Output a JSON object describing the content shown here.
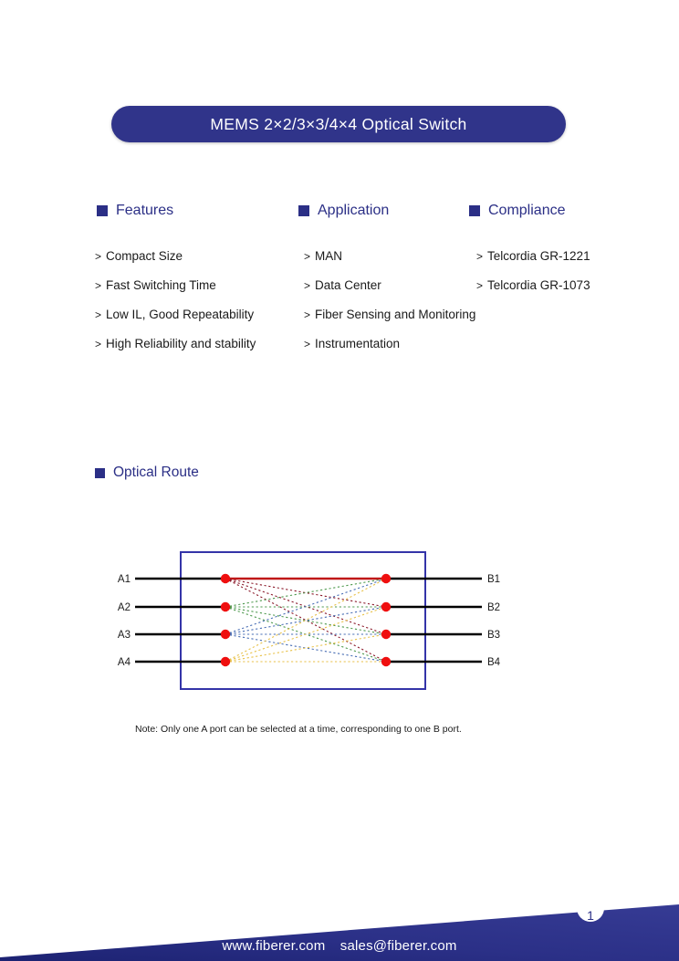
{
  "page": {
    "title": "MEMS 2×2/3×3/4×4 Optical Switch",
    "page_number": "1",
    "accent_color": "#30348a",
    "text_color": "#1a1a1a"
  },
  "sections": {
    "features": {
      "heading": "Features",
      "bullet_mark": ">",
      "items": [
        "Compact Size",
        "Fast Switching Time",
        "Low IL, Good Repeatability",
        "High Reliability and stability"
      ]
    },
    "application": {
      "heading": "Application",
      "bullet_mark": ">",
      "items": [
        "MAN",
        "Data Center",
        "Fiber Sensing and Monitoring",
        "Instrumentation"
      ]
    },
    "compliance": {
      "heading": "Compliance",
      "bullet_mark": ">",
      "items": [
        "Telcordia GR-1221",
        "Telcordia GR-1073"
      ]
    },
    "optical_route": {
      "heading": "Optical Route",
      "note": "Note: Only one A port can be selected at a time, corresponding to one B port."
    }
  },
  "diagram": {
    "box_border_color": "#3434a8",
    "node_color": "#ef0f0f",
    "lead_color": "#000000",
    "active_route_color": "#c01818",
    "input_labels": [
      "A1",
      "A2",
      "A3",
      "A4"
    ],
    "output_labels": [
      "B1",
      "B2",
      "B3",
      "B4"
    ],
    "input_colors": [
      "#8b1a2b",
      "#4f9a4f",
      "#4a6fb5",
      "#e8c24a"
    ],
    "active_route": {
      "from": "A1",
      "to": "B1"
    },
    "routes": [
      {
        "from": "A1",
        "to": "B1"
      },
      {
        "from": "A1",
        "to": "B2"
      },
      {
        "from": "A1",
        "to": "B3"
      },
      {
        "from": "A1",
        "to": "B4"
      },
      {
        "from": "A2",
        "to": "B1"
      },
      {
        "from": "A2",
        "to": "B2"
      },
      {
        "from": "A2",
        "to": "B3"
      },
      {
        "from": "A2",
        "to": "B4"
      },
      {
        "from": "A3",
        "to": "B1"
      },
      {
        "from": "A3",
        "to": "B2"
      },
      {
        "from": "A3",
        "to": "B3"
      },
      {
        "from": "A3",
        "to": "B4"
      },
      {
        "from": "A4",
        "to": "B1"
      },
      {
        "from": "A4",
        "to": "B2"
      },
      {
        "from": "A4",
        "to": "B3"
      },
      {
        "from": "A4",
        "to": "B4"
      }
    ]
  },
  "footer": {
    "website": "www.fiberer.com",
    "email": "sales@fiberer.com",
    "background_color": "#2b3087"
  }
}
